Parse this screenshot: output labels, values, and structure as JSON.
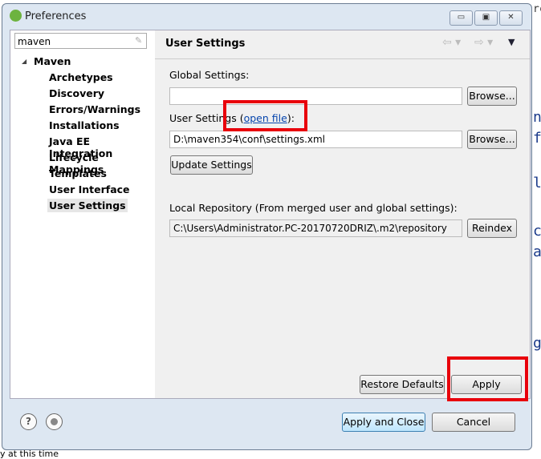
{
  "window": {
    "title": "Preferences",
    "minimize": "▭",
    "maximize": "▣",
    "close": "✕"
  },
  "background": {
    "top_right": "rc",
    "fragments": [
      "n",
      "f",
      "l",
      "c",
      "a",
      "g"
    ],
    "bottom": "y at this time"
  },
  "sidebar": {
    "search_value": "maven",
    "root": "Maven",
    "items": [
      "Archetypes",
      "Discovery",
      "Errors/Warnings",
      "Installations",
      "Java EE Integration",
      "Lifecycle Mappings",
      "Templates",
      "User Interface",
      "User Settings"
    ],
    "selected": "User Settings"
  },
  "page": {
    "title": "User Settings",
    "global_label": "Global Settings:",
    "global_value": "",
    "browse": "Browse...",
    "user_label_pre": "User Settings (",
    "open_file": "open file",
    "user_label_post": "):",
    "user_value": "D:\\maven354\\conf\\settings.xml",
    "update": "Update Settings",
    "local_label": "Local Repository (From merged user and global settings):",
    "local_value": "C:\\Users\\Administrator.PC-20170720DRIZ\\.m2\\repository",
    "reindex": "Reindex",
    "restore": "Restore Defaults",
    "apply": "Apply"
  },
  "footer": {
    "apply_close": "Apply and Close",
    "cancel": "Cancel",
    "help": "?"
  },
  "colors": {
    "highlight": "#e8000b",
    "link": "#0645ad"
  }
}
